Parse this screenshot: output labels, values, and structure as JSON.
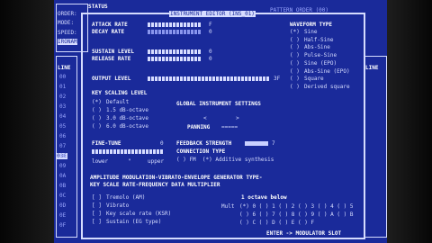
{
  "window": {
    "title": "INSTRUMENT EDITOR (INS_01)",
    "top_strip": "PATTERN ORDER (00)",
    "status_label": "STATUS",
    "left_labels": [
      "ORDER:",
      "MODE:",
      "SPEED:",
      "IRONAM"
    ],
    "line_label": "LINE",
    "right_col_label": "LINE"
  },
  "adsr": {
    "attack_label": "ATTACK RATE",
    "attack_value": "F",
    "decay_label": "DECAY RATE",
    "decay_value": "0",
    "sustain_label": "SUSTAIN LEVEL",
    "sustain_value": "0",
    "release_label": "RELEASE RATE",
    "release_value": "0",
    "output_label": "OUTPUT LEVEL",
    "output_value": "3F"
  },
  "waveform": {
    "title": "WAVEFORM TYPE",
    "options": [
      {
        "mark": "(*)",
        "label": "Sine"
      },
      {
        "mark": "( )",
        "label": "Half-Sine"
      },
      {
        "mark": "( )",
        "label": "Abs-Sine"
      },
      {
        "mark": "( )",
        "label": "Pulse-Sine"
      },
      {
        "mark": "( )",
        "label": "Sine (EPO)"
      },
      {
        "mark": "( )",
        "label": "Abs-Sine (EPO)"
      },
      {
        "mark": "( )",
        "label": "Square"
      },
      {
        "mark": "( )",
        "label": "Derived square"
      }
    ]
  },
  "key_scaling": {
    "title": "KEY SCALING LEVEL",
    "options": [
      {
        "mark": "(*)",
        "label": "Default"
      },
      {
        "mark": "( )",
        "label": "1.5 dB-octave"
      },
      {
        "mark": "( )",
        "label": "3.0 dB-octave"
      },
      {
        "mark": "( )",
        "label": "6.0 dB-octave"
      }
    ]
  },
  "global": {
    "title": "GLOBAL INSTRUMENT SETTINGS",
    "arrows": "<         >",
    "panning_label": "PANNING",
    "panning_value": "=====",
    "feedback_label": "FEEDBACK STRENGTH",
    "feedback_value": "7",
    "connection_title": "CONNECTION TYPE",
    "connection_opts": "( ) FM  (*) Additive synthesis"
  },
  "finetune": {
    "label": "FINE-TUNE",
    "value": "0",
    "lower": "lower",
    "mid": "\"",
    "upper": "upper"
  },
  "amp": {
    "header": "AMPLITUDE MODULATION-VIBRATO-ENVELOPE GENERATOR TYPE-",
    "header2": "KEY SCALE RATE-FREQUENCY DATA MULTIPLIER",
    "checks": [
      {
        "mark": "[ ]",
        "label": "Tremolo (AM)"
      },
      {
        "mark": "[ ]",
        "label": "Vibrato"
      },
      {
        "mark": "[ ]",
        "label": "Key scale rate (KSR)"
      },
      {
        "mark": "[ ]",
        "label": "Sustain (EG type)"
      }
    ],
    "octave_title": "1 octave below",
    "mult_label": "Mult",
    "mult_rows": [
      "(*) 0 ( ) 1 ( ) 2 ( ) 3 ( ) 4 ( ) 5",
      "( ) 6 ( ) 7 ( ) 8 ( ) 9 ( ) A ( ) B",
      "( ) C ( ) D ( ) E ( ) F"
    ]
  },
  "footer": {
    "hint": "ENTER -> MODULATOR SLOT"
  },
  "left_rows": [
    "00",
    "01",
    "02",
    "03",
    "04",
    "05",
    "06",
    "07",
    "08",
    "09",
    "0A",
    "0B",
    "0C",
    "0D",
    "0E",
    "0F"
  ],
  "cursor_row": "03E"
}
